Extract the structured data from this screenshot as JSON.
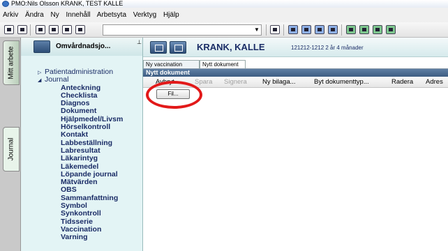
{
  "window": {
    "title": "PMO:Nils Olsson  KRANK, TEST KALLE"
  },
  "menubar": {
    "items": [
      "Arkiv",
      "Ändra",
      "Ny",
      "Innehåll",
      "Arbetsyta",
      "Verktyg",
      "Hjälp"
    ]
  },
  "side_tabs": {
    "work": "Mitt arbete",
    "journal": "Journal"
  },
  "nav": {
    "header": "Omvårdnadsjo...",
    "pin_icon": "pushpin-icon",
    "patient_admin": "Patientadministration",
    "journal": "Journal",
    "journal_items": [
      "Anteckning",
      "Checklista",
      "Diagnos",
      "Dokument",
      "Hjälpmedel/Livsm",
      "Hörselkontroll",
      "Kontakt",
      "Labbeställning",
      "Labresultat",
      "Läkarintyg",
      "Läkemedel",
      "Löpande journal",
      "Mätvärden",
      "OBS",
      "Sammanfattning",
      "Symbol",
      "Synkontroll",
      "Tidsserie",
      "Vaccination",
      "Varning"
    ]
  },
  "patient": {
    "name": "KRANK, KALLE",
    "id_info": "121212-1212  2 år 4 månader"
  },
  "doc_tabs": {
    "vaccination": "Ny vaccination",
    "document": "Nytt dokument"
  },
  "panel": {
    "title": "Nytt dokument",
    "actions": {
      "cancel": "Avbryt",
      "save": "Spara",
      "sign": "Signera",
      "new_attachment": "Ny bilaga...",
      "change_type": "Byt dokumenttyp...",
      "delete": "Radera",
      "address": "Adres"
    },
    "file_button": "Fil..."
  },
  "colors": {
    "highlight_circle": "#e21919",
    "panel_header": "#4a6a8f",
    "nav_background": "#e3f4f5"
  }
}
